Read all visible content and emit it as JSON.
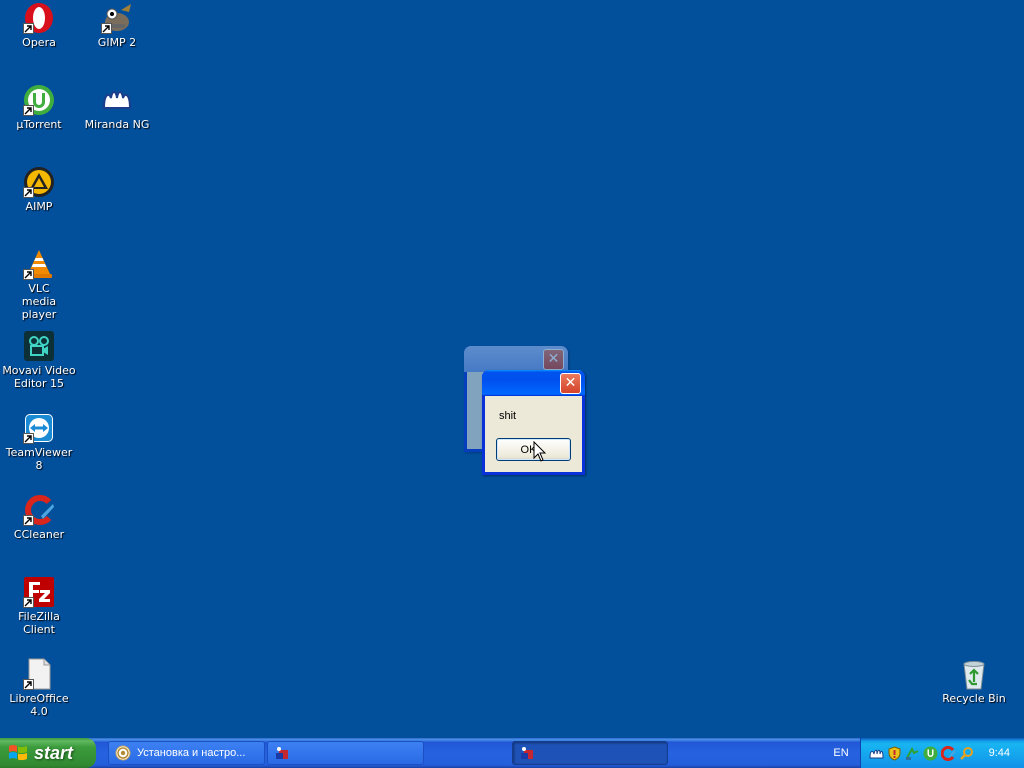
{
  "desktop_icons": [
    {
      "label": "Opera",
      "icon": "opera-icon"
    },
    {
      "label": "GIMP 2",
      "icon": "gimp-icon"
    },
    {
      "label": "µTorrent",
      "icon": "utorrent-icon"
    },
    {
      "label": "Miranda NG",
      "icon": "miranda-icon"
    },
    {
      "label": "AIMP",
      "icon": "aimp-icon"
    },
    {
      "label": "VLC media player",
      "icon": "vlc-icon"
    },
    {
      "label": "Movavi Video Editor 15",
      "icon": "movavi-icon"
    },
    {
      "label": "TeamViewer 8",
      "icon": "teamviewer-icon"
    },
    {
      "label": "CCleaner",
      "icon": "ccleaner-icon"
    },
    {
      "label": "FileZilla Client",
      "icon": "filezilla-icon"
    },
    {
      "label": "LibreOffice 4.0",
      "icon": "libreoffice-icon"
    },
    {
      "label": "Recycle Bin",
      "icon": "recycle-bin-icon"
    }
  ],
  "message_box": {
    "text": "shit",
    "ok_label": "OK"
  },
  "taskbar": {
    "start_label": "start",
    "tasks": [
      {
        "label": "Установка и настро...",
        "icon": "chrome-icon"
      },
      {
        "label": "",
        "icon": "app-icon"
      },
      {
        "label": "",
        "icon": "app-icon"
      }
    ],
    "language": "EN",
    "clock": "9:44",
    "tray_icons": [
      "miranda-tray-icon",
      "shield-tray-icon",
      "network-tray-icon",
      "utorrent-tray-icon",
      "ccleaner-tray-icon",
      "search-tray-icon"
    ]
  },
  "colors": {
    "desktop_background": "#024f9c",
    "taskbar_blue": "#245edb",
    "start_green": "#3c9c3c",
    "title_blue": "#0053ee",
    "close_red": "#d4432a"
  }
}
